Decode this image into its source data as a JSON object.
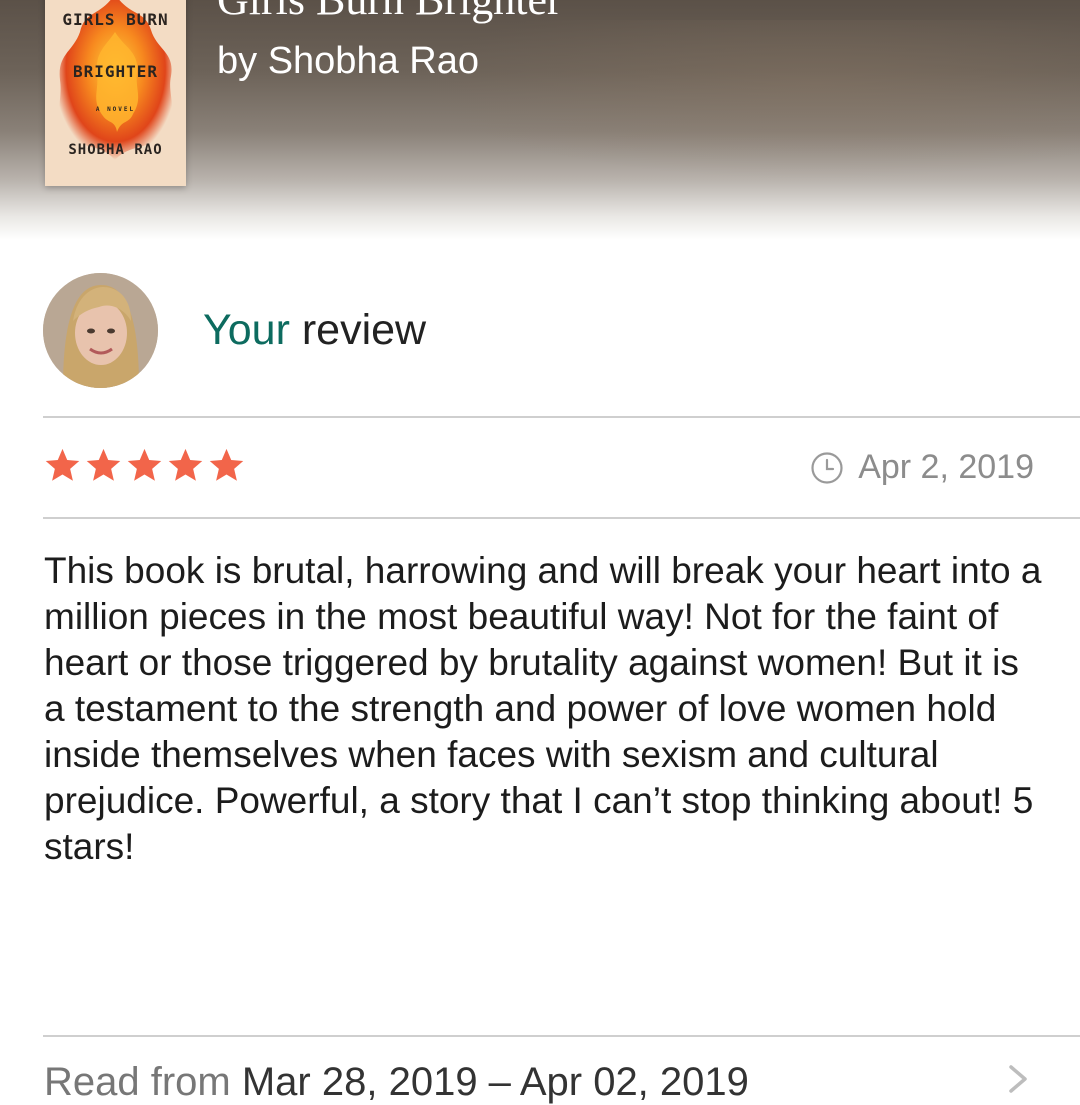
{
  "book": {
    "title": "Girls Burn Brighter",
    "author_line": "by Shobha Rao",
    "cover": {
      "title_line_1": "GIRLS BURN",
      "title_line_2": "BRIGHTER",
      "subtitle": "A NOVEL",
      "author": "SHOBHA RAO"
    }
  },
  "review": {
    "heading_accent": "Your",
    "heading_rest": " review",
    "rating": 5,
    "rating_max": 5,
    "date": "Apr 2, 2019",
    "body": "This book is brutal, harrowing and will break your heart into a million pieces in the most beautiful way! Not for the faint of heart or those triggered by brutality against women! But it is a testament to the strength and power of love women hold inside themselves when faces with sexism and cultural prejudice. Powerful, a story that I can’t stop thinking about! 5 stars!"
  },
  "read_dates": {
    "label": "Read from",
    "value": " Mar 28, 2019 – Apr 02, 2019"
  },
  "colors": {
    "accent": "#0d6b5f",
    "star": "#f2654a",
    "date": "#8c8c8c"
  },
  "icons": {
    "date": "clock-icon",
    "rating": "star-icon",
    "more": "chevron-right-icon"
  }
}
